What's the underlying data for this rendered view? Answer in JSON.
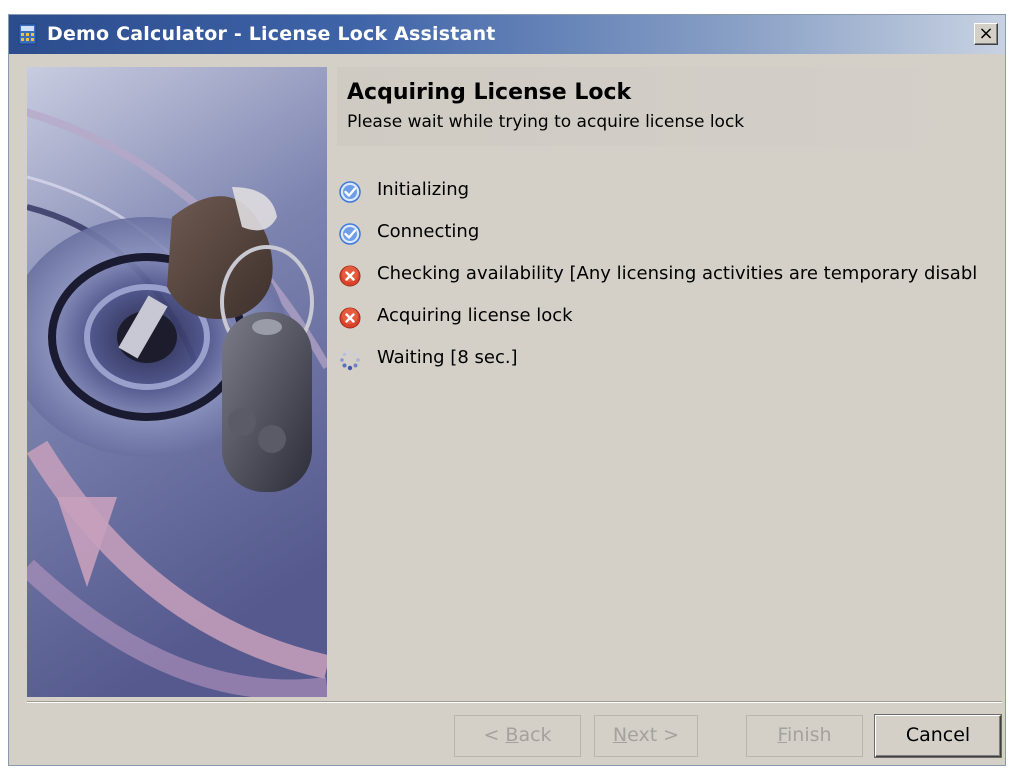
{
  "window": {
    "title": "Demo Calculator - License Lock Assistant",
    "close_glyph": "×"
  },
  "header": {
    "title": "Acquiring License Lock",
    "subtitle": "Please wait while trying to acquire license lock"
  },
  "steps": [
    {
      "label": "Initializing",
      "status": "done",
      "icon": "check-icon"
    },
    {
      "label": "Connecting",
      "status": "done",
      "icon": "check-icon"
    },
    {
      "label": "Checking availability [Any licensing activities are temporary disabl",
      "status": "error",
      "icon": "error-icon"
    },
    {
      "label": "Acquiring license lock",
      "status": "error",
      "icon": "error-icon"
    },
    {
      "label": "Waiting [8 sec.]",
      "status": "pending",
      "icon": "spinner-icon"
    }
  ],
  "buttons": {
    "back": {
      "prefix": "< ",
      "accel": "B",
      "rest": "ack"
    },
    "next": {
      "accel": "N",
      "rest": "ext >"
    },
    "finish": {
      "accel": "F",
      "rest": "inish"
    },
    "cancel": "Cancel"
  },
  "colors": {
    "title_gradient_start": "#2b4c8d",
    "title_gradient_end": "#c8d2e2",
    "dialog_bg": "#d4d0c8",
    "check_blue": "#3f78d8",
    "error_red": "#d9432a"
  }
}
